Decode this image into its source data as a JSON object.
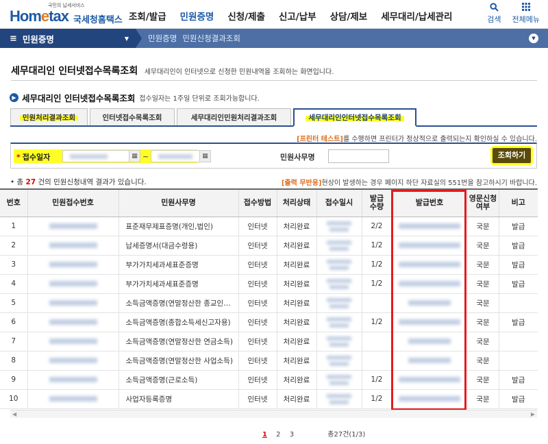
{
  "header": {
    "logo_small": "국민의 납세서비스",
    "logo_main_pre": "Hom",
    "logo_main_e": "e",
    "logo_main_post": "tax",
    "logo_sub": "국세청홈택스",
    "gnb": [
      "조회/발급",
      "민원증명",
      "신청/제출",
      "신고/납부",
      "상담/제보",
      "세무대리/납세관리"
    ],
    "gnb_active_index": 1,
    "search_label": "검색",
    "allmenu_label": "전체메뉴"
  },
  "subnav": {
    "menu_label": "민원증명",
    "crumb_1": "민원증명",
    "crumb_2": "민원신청결과조회"
  },
  "page": {
    "title": "세무대리인 인터넷접수목록조회",
    "desc": "세무대리인이 인터넷으로 신청한 민원내역을 조회하는 화면입니다.",
    "section_title": "세무대리인 인터넷접수목록조회",
    "section_desc": "접수일자는 1주일 단위로 조회가능합니다."
  },
  "tabs": [
    {
      "label": "민원처리결과조회",
      "selected": false,
      "highlight": true
    },
    {
      "label": "인터넷접수목록조회",
      "selected": false,
      "highlight": false
    },
    {
      "label": "세무대리인민원처리결과조회",
      "selected": false,
      "highlight": false
    },
    {
      "label": "세무대리인인터넷접수목록조회",
      "selected": true,
      "highlight": true
    }
  ],
  "notice": {
    "orange": "[프린터 테스트]",
    "rest": "를 수행하면 프린터가 정상적으로 출력되는지 확인하실 수 있습니다."
  },
  "search": {
    "date_label": "접수일자",
    "tilde": "~",
    "field_label": "민원사무명",
    "field_value": "",
    "button_label": "조회하기"
  },
  "result": {
    "prefix": "• 총 ",
    "count": "27",
    "suffix": " 건의 민원신청내역 결과가 있습니다.",
    "note_orange": "[출력 무반응]",
    "note_rest": "현상이 발생하는 경우 페이지 하단 자료실의 551번을 참고하시기 바랍니다."
  },
  "table": {
    "headers": [
      "번호",
      "민원접수번호",
      "민원사무명",
      "접수방법",
      "처리상태",
      "접수일시",
      "발급\n수량",
      "발급번호",
      "영문신청\n여부",
      "비고"
    ],
    "rows": [
      {
        "no": "1",
        "name": "표준재무제표증명(개인,법인)",
        "method": "인터넷",
        "status": "처리완료",
        "qty": "2/2",
        "has_issue_no": true,
        "eng": "국문",
        "note": "발급"
      },
      {
        "no": "2",
        "name": "납세증명서(대금수령용)",
        "method": "인터넷",
        "status": "처리완료",
        "qty": "1/2",
        "has_issue_no": true,
        "eng": "국문",
        "note": "발급"
      },
      {
        "no": "3",
        "name": "부가가치세과세표준증명",
        "method": "인터넷",
        "status": "처리완료",
        "qty": "1/2",
        "has_issue_no": true,
        "eng": "국문",
        "note": "발급"
      },
      {
        "no": "4",
        "name": "부가가치세과세표준증명",
        "method": "인터넷",
        "status": "처리완료",
        "qty": "1/2",
        "has_issue_no": true,
        "eng": "국문",
        "note": "발급"
      },
      {
        "no": "5",
        "name": "소득금액증명(연말정산한 종교인…",
        "method": "인터넷",
        "status": "처리완료",
        "qty": "",
        "has_issue_no": true,
        "eng": "국문",
        "note": ""
      },
      {
        "no": "6",
        "name": "소득금액증명(종합소득세신고자용)",
        "method": "인터넷",
        "status": "처리완료",
        "qty": "1/2",
        "has_issue_no": true,
        "eng": "국문",
        "note": "발급"
      },
      {
        "no": "7",
        "name": "소득금액증명(연말정산한 연금소득)",
        "method": "인터넷",
        "status": "처리완료",
        "qty": "",
        "has_issue_no": true,
        "eng": "국문",
        "note": ""
      },
      {
        "no": "8",
        "name": "소득금액증명(연말정산한 사업소득)",
        "method": "인터넷",
        "status": "처리완료",
        "qty": "",
        "has_issue_no": true,
        "eng": "국문",
        "note": ""
      },
      {
        "no": "9",
        "name": "소득금액증명(근로소득)",
        "method": "인터넷",
        "status": "처리완료",
        "qty": "1/2",
        "has_issue_no": true,
        "eng": "국문",
        "note": "발급"
      },
      {
        "no": "10",
        "name": "사업자등록증명",
        "method": "인터넷",
        "status": "처리완료",
        "qty": "1/2",
        "has_issue_no": true,
        "eng": "국문",
        "note": "발급"
      }
    ]
  },
  "pager": {
    "current": "1",
    "pages": [
      "2",
      "3"
    ],
    "total": "총27건(1/3)"
  },
  "colors": {
    "brand_blue": "#1b5aa6",
    "nav_dark": "#22457e",
    "nav_mid": "#4d6fa6",
    "highlight_yellow": "#ffff00",
    "annotation_red": "#e31b1b",
    "button_dark": "#5a4a0a"
  }
}
